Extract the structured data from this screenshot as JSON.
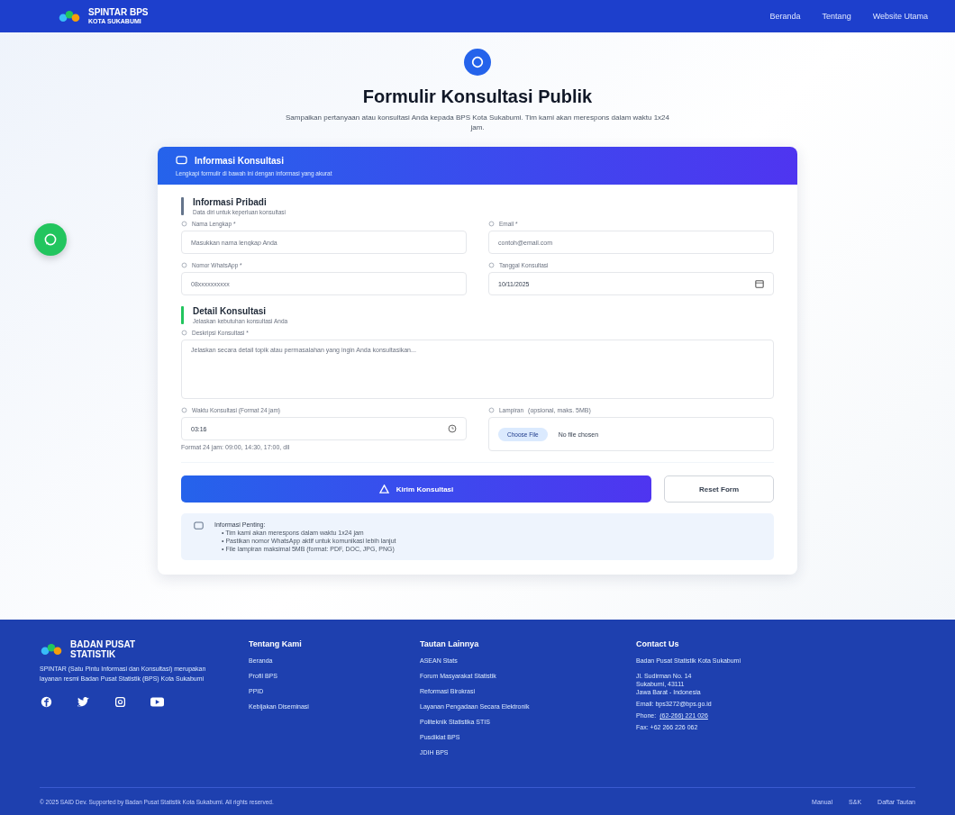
{
  "navbar": {
    "brand": "SPINTAR BPS",
    "brand_sub": "KOTA SUKABUMI",
    "links": [
      "Beranda",
      "Tentang",
      "Website Utama"
    ]
  },
  "hero": {
    "title": "Formulir Konsultasi Publik",
    "subtitle": "Sampaikan pertanyaan atau konsultasi Anda kepada BPS Kota Sukabumi. Tim kami akan merespons dalam waktu 1x24 jam."
  },
  "card": {
    "title": "Informasi Konsultasi",
    "subtitle": "Lengkapi formulir di bawah ini dengan informasi yang akurat",
    "sections": [
      {
        "title": "Informasi Pribadi",
        "subtitle": "Data diri untuk keperluan konsultasi",
        "color": "#64748b",
        "fields": [
          {
            "kind": "text",
            "label": "Nama Lengkap *",
            "placeholder": "Masukkan nama lengkap Anda"
          },
          {
            "kind": "text",
            "label": "Email *",
            "placeholder": "contoh@email.com"
          },
          {
            "kind": "text",
            "label": "Nomor WhatsApp *",
            "placeholder": "08xxxxxxxxxx"
          },
          {
            "kind": "date",
            "label": "Tanggal Konsultasi",
            "value": "10/11/2025"
          }
        ]
      },
      {
        "title": "Detail Konsultasi",
        "subtitle": "Jelaskan kebutuhan konsultasi Anda",
        "color": "#22c55e",
        "fields": [
          {
            "kind": "textarea",
            "label": "Deskripsi Konsultasi *",
            "placeholder": "Jelaskan secara detail topik atau permasalahan yang ingin Anda konsultasikan..."
          },
          {
            "kind": "time",
            "label": "Waktu Konsultasi (Format 24 jam)",
            "value": "03:16",
            "hint": "Format 24 jam: 09:00, 14:30, 17:00, dll"
          },
          {
            "kind": "file",
            "label": "Lampiran",
            "note": "(opsional, maks. 5MB)",
            "button": "Choose File",
            "value": "No file chosen"
          }
        ]
      }
    ],
    "submit": "Kirim Konsultasi",
    "reset": "Reset Form",
    "info": {
      "title": "Informasi Penting:",
      "items": [
        "• Tim kami akan merespons dalam waktu 1x24 jam",
        "• Pastikan nomor WhatsApp aktif untuk komunikasi lebih lanjut",
        "• File lampiran maksimal 5MB (format: PDF, DOC, JPG, PNG)"
      ]
    }
  },
  "footer": {
    "brand": "BADAN PUSAT STATISTIK",
    "description": "SPINTAR (Satu Pintu Informasi dan Konsultasi) merupakan layanan resmi Badan Pusat Statistik (BPS) Kota Sukabumi",
    "columns": [
      {
        "title": "Tentang Kami",
        "links": [
          "Beranda",
          "Profil BPS",
          "PPID",
          "Kebijakan Diseminasi"
        ]
      },
      {
        "title": "Tautan Lainnya",
        "links": [
          "ASEAN Stats",
          "Forum Masyarakat Statistik",
          "Reformasi Birokrasi",
          "Layanan Pengadaan Secara Elektronik",
          "Politeknik Statistika STIS",
          "Pusdiklat BPS",
          "JDIH BPS"
        ]
      }
    ],
    "contact": {
      "title": "Contact Us",
      "name": "Badan Pusat Statistik Kota Sukabumi",
      "address": [
        "Jl. Sudirman No. 14",
        "Sukabumi, 43111",
        "Jawa Barat - Indonesia"
      ],
      "email": "Email: bps3272@bps.go.id",
      "phone_label": "Phone:",
      "phone": "(62-266) 221 026",
      "fax": "Fax: +62 266 226 062"
    },
    "copyright": "© 2025 SAID Dev. Supported by Badan Pusat Statistik Kota Sukabumi. All rights reserved.",
    "bottom_links": [
      "Manual",
      "S&K",
      "Daftar Tautan"
    ]
  }
}
